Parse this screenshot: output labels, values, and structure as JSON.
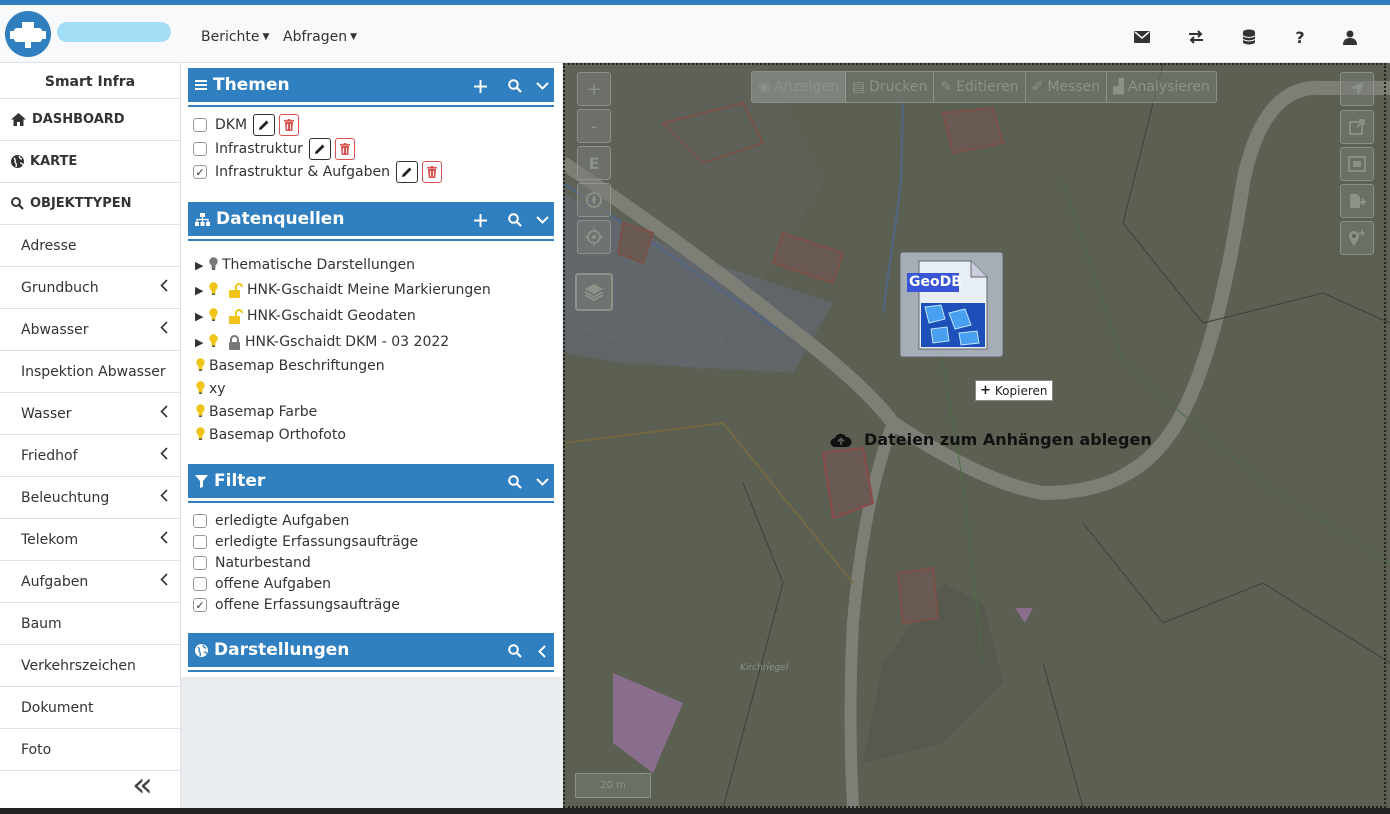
{
  "nav": {
    "menus": [
      {
        "label": "Berichte"
      },
      {
        "label": "Abfragen"
      }
    ],
    "icons": [
      "envelope-icon",
      "exchange-icon",
      "database-icon",
      "help-icon",
      "user-icon"
    ]
  },
  "sidebar": {
    "title": "Smart Infra",
    "main_items": [
      {
        "label": "DASHBOARD",
        "icon": "home-icon"
      },
      {
        "label": "KARTE",
        "icon": "globe-icon"
      },
      {
        "label": "OBJEKTTYPEN",
        "icon": "search-icon"
      }
    ],
    "items": [
      {
        "label": "Adresse",
        "expandable": false
      },
      {
        "label": "Grundbuch",
        "expandable": true
      },
      {
        "label": "Abwasser",
        "expandable": true
      },
      {
        "label": "Inspektion Abwasser",
        "expandable": false
      },
      {
        "label": "Wasser",
        "expandable": true
      },
      {
        "label": "Friedhof",
        "expandable": true
      },
      {
        "label": "Beleuchtung",
        "expandable": true
      },
      {
        "label": "Telekom",
        "expandable": true
      },
      {
        "label": "Aufgaben",
        "expandable": true
      },
      {
        "label": "Baum",
        "expandable": false
      },
      {
        "label": "Verkehrszeichen",
        "expandable": false
      },
      {
        "label": "Dokument",
        "expandable": false
      },
      {
        "label": "Foto",
        "expandable": false
      }
    ],
    "collapse_label": "«"
  },
  "themen": {
    "title": "Themen",
    "items": [
      {
        "label": "DKM",
        "checked": false
      },
      {
        "label": "Infrastruktur",
        "checked": false
      },
      {
        "label": "Infrastruktur & Aufgaben",
        "checked": true
      }
    ]
  },
  "datenquellen": {
    "title": "Datenquellen",
    "items": [
      {
        "label": "Thematische Darstellungen",
        "expander": true,
        "bulb": "gray",
        "lock": "none"
      },
      {
        "label": "HNK-Gschaidt Meine Markierungen",
        "expander": true,
        "bulb": "yellow",
        "lock": "yellow-open"
      },
      {
        "label": "HNK-Gschaidt Geodaten",
        "expander": true,
        "bulb": "yellow",
        "lock": "yellow-open"
      },
      {
        "label": "HNK-Gschaidt DKM - 03 2022",
        "expander": true,
        "bulb": "yellow",
        "lock": "gray-closed"
      },
      {
        "label": "Basemap Beschriftungen",
        "expander": false,
        "bulb": "yellow",
        "lock": "none"
      },
      {
        "label": "xy",
        "expander": false,
        "bulb": "yellow",
        "lock": "none"
      },
      {
        "label": "Basemap Farbe",
        "expander": false,
        "bulb": "yellow",
        "lock": "none"
      },
      {
        "label": "Basemap Orthofoto",
        "expander": false,
        "bulb": "yellow",
        "lock": "none"
      }
    ]
  },
  "filter": {
    "title": "Filter",
    "items": [
      {
        "label": "erledigte Aufgaben",
        "checked": false
      },
      {
        "label": "erledigte Erfassungsaufträge",
        "checked": false
      },
      {
        "label": "Naturbestand",
        "checked": false
      },
      {
        "label": "offene Aufgaben",
        "checked": false
      },
      {
        "label": "offene Erfassungsaufträge",
        "checked": true
      }
    ]
  },
  "darstellungen": {
    "title": "Darstellungen"
  },
  "map": {
    "left_controls": [
      "+",
      "-",
      "E"
    ],
    "toolbar": [
      {
        "label": "Anzeigen",
        "icon": "eye-icon"
      },
      {
        "label": "Drucken",
        "icon": "print-icon"
      },
      {
        "label": "Editieren",
        "icon": "pencil-icon"
      },
      {
        "label": "Messen",
        "icon": "ruler-icon"
      },
      {
        "label": "Analysieren",
        "icon": "chart-icon"
      }
    ],
    "drop_text": "Dateien zum Anhängen ablegen",
    "drag_file_label": "GeoDB",
    "copy_tooltip": "Kopieren",
    "scale_label": "20 m",
    "place_label": "Kirchriegel"
  },
  "colors": {
    "primary": "#2f7fc1",
    "danger": "#d9534f",
    "bulb_yellow": "#f0c419",
    "bulb_gray": "#777777"
  }
}
